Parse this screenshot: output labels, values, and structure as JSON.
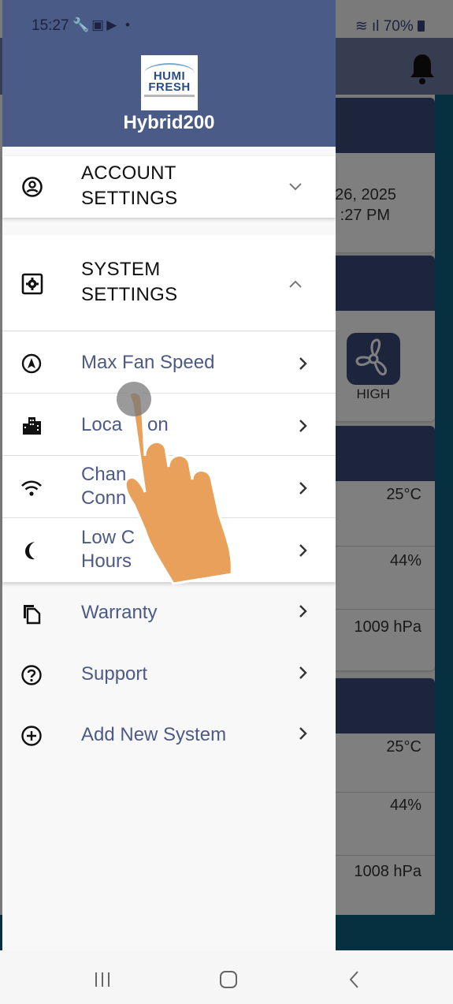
{
  "status_bar": {
    "time": "15:27",
    "notification_icons": [
      "wrench-icon",
      "image-icon",
      "youtube-icon",
      "dot"
    ],
    "battery": "70%"
  },
  "background": {
    "date_partial": "26, 2025",
    "time_partial": ":27 PM",
    "fan_level": "HIGH",
    "card1": {
      "temperature": "25°C",
      "humidity": "44%",
      "pressure": "1009 hPa"
    },
    "card2": {
      "temperature": "25°C",
      "humidity": "44%",
      "pressure": "1008 hPa"
    }
  },
  "drawer": {
    "logo_line1": "HUMI",
    "logo_line2": "FRESH",
    "device_name": "Hybrid200",
    "account_settings": {
      "line1": "ACCOUNT",
      "line2": "SETTINGS",
      "icon": "account-circle-icon",
      "expanded": false
    },
    "system_settings": {
      "line1": "SYSTEM",
      "line2": "SETTINGS",
      "icon": "gear-box-icon",
      "expanded": true
    },
    "system_items": [
      {
        "line1": "Max Fan Speed",
        "line2": "",
        "icon": "navigation-compass-icon"
      },
      {
        "line1": "Loca",
        "line1b": "on",
        "line2": "",
        "icon": "city-icon"
      },
      {
        "line1": "Chan",
        "line2": "Conn",
        "icon": "wifi-icon"
      },
      {
        "line1": "Low C",
        "line2": "Hours",
        "icon": "moon-icon"
      }
    ],
    "other_items": [
      {
        "label": "Warranty",
        "icon": "copy-icon"
      },
      {
        "label": "Support",
        "icon": "help-circle-icon"
      },
      {
        "label": "Add New System",
        "icon": "plus-circle-icon"
      }
    ]
  },
  "colors": {
    "drawer_header": "#4b5b87",
    "item_text": "#4c5a85",
    "card_header": "#3a4a78"
  }
}
